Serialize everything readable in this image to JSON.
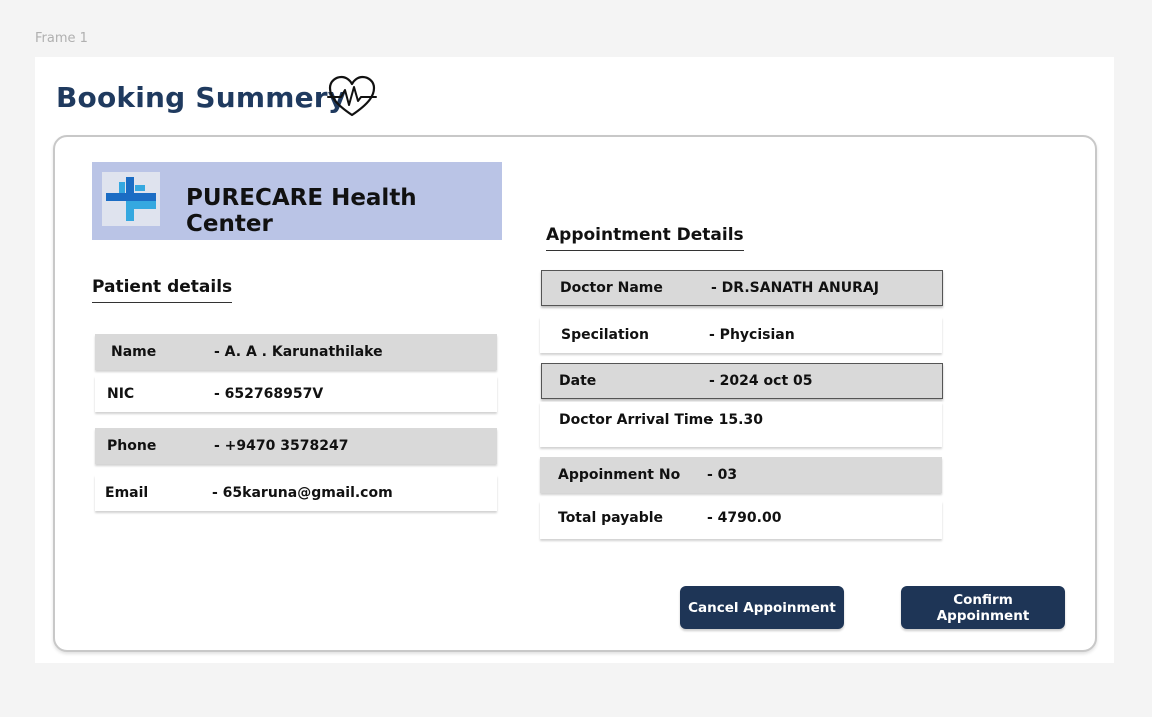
{
  "frame_label": "Frame 1",
  "page": {
    "title": "Booking Summery"
  },
  "clinic": {
    "name": "PURECARE Health Center"
  },
  "patient": {
    "heading": "Patient details",
    "rows": [
      {
        "label": "Name",
        "value": "-  A. A . Karunathilake"
      },
      {
        "label": "NIC",
        "value": "- 652768957V"
      },
      {
        "label": "Phone",
        "value": "- +9470 3578247"
      },
      {
        "label": "Email",
        "value": "- 65karuna@gmail.com"
      }
    ]
  },
  "appointment": {
    "heading": "Appointment Details",
    "rows": [
      {
        "label": "Doctor Name",
        "value": "- DR.SANATH ANURAJ"
      },
      {
        "label": "Specilation",
        "value": "- Phycisian"
      },
      {
        "label": "Date",
        "value": "- 2024 oct 05"
      },
      {
        "label": "Doctor Arrival Time",
        "value": "- 15.30"
      },
      {
        "label": "Appoinment No",
        "value": "-  03"
      },
      {
        "label": "Total  payable",
        "value": "- 4790.00"
      }
    ]
  },
  "actions": {
    "cancel_label": "Cancel Appoinment",
    "confirm_label": "Confirm Appoinment"
  },
  "colors": {
    "primary": "#1e3556",
    "title": "#1f3a5f",
    "brand_bg": "#bac4e6",
    "row_grey": "#d9d9d9",
    "logo_blue_dark": "#1b6cc4",
    "logo_blue_light": "#35a8e0"
  },
  "icons": {
    "title_icon": "heartbeat-icon",
    "brand_logo": "medical-cross-icon"
  }
}
